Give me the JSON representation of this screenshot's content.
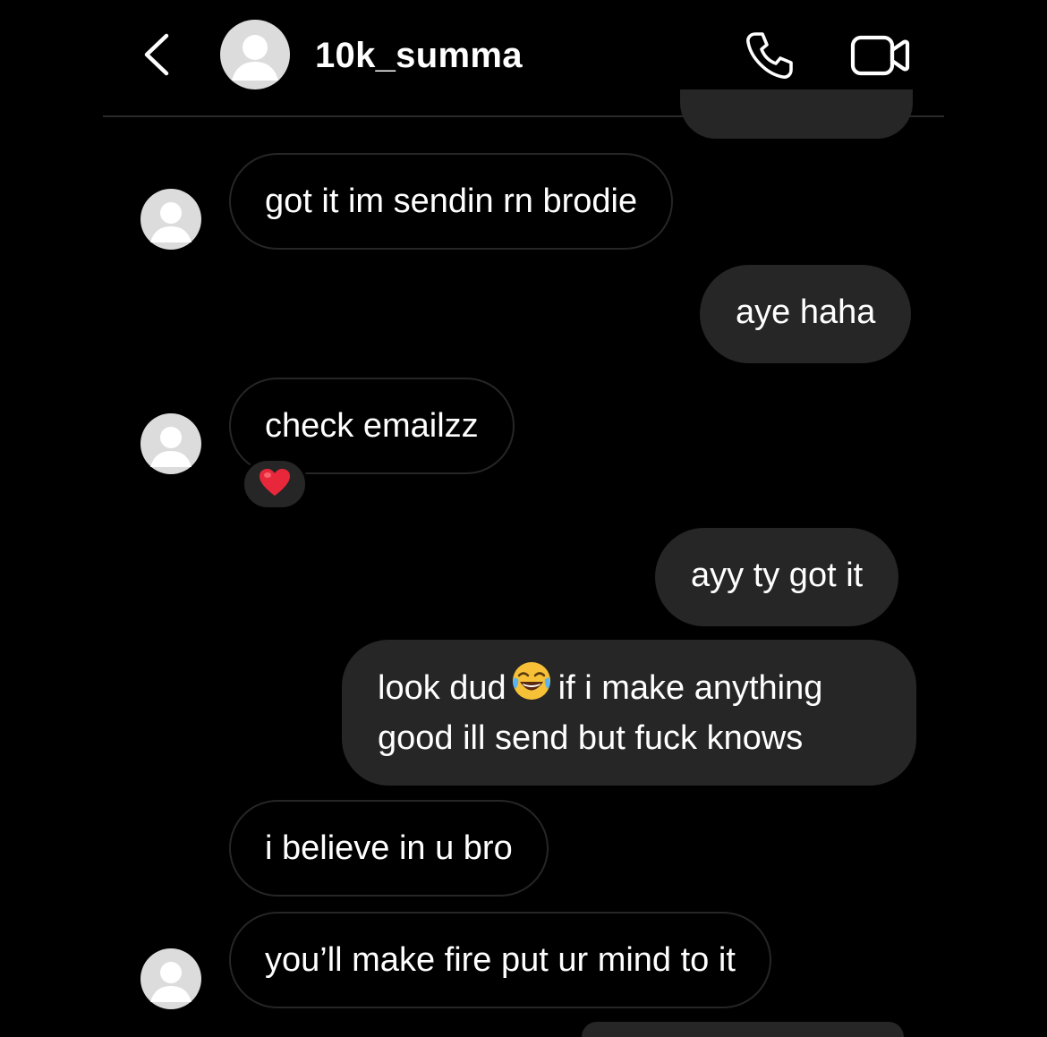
{
  "header": {
    "username": "10k_summa",
    "back_icon": "chevron-left-icon",
    "call_icon": "phone-icon",
    "video_icon": "video-camera-icon"
  },
  "messages": [
    {
      "from": "them",
      "text": "got it im sendin rn brodie"
    },
    {
      "from": "me",
      "text": "aye haha"
    },
    {
      "from": "them",
      "text": "check emailzz",
      "reaction": "heart"
    },
    {
      "from": "me",
      "text": "ayy ty got it"
    },
    {
      "from": "me",
      "line1_before": "look dud",
      "emoji": "joy-emoji",
      "line1_after": "if i make anything",
      "line2": "good ill send but fuck knows"
    },
    {
      "from": "them",
      "text": "i believe in u bro"
    },
    {
      "from": "them",
      "text": "you’ll make fire put ur mind to it"
    }
  ],
  "colors": {
    "background": "#000000",
    "outgoing_bubble": "#262626",
    "incoming_border": "#262626",
    "text": "#ffffff",
    "heart": "#e8283a"
  }
}
